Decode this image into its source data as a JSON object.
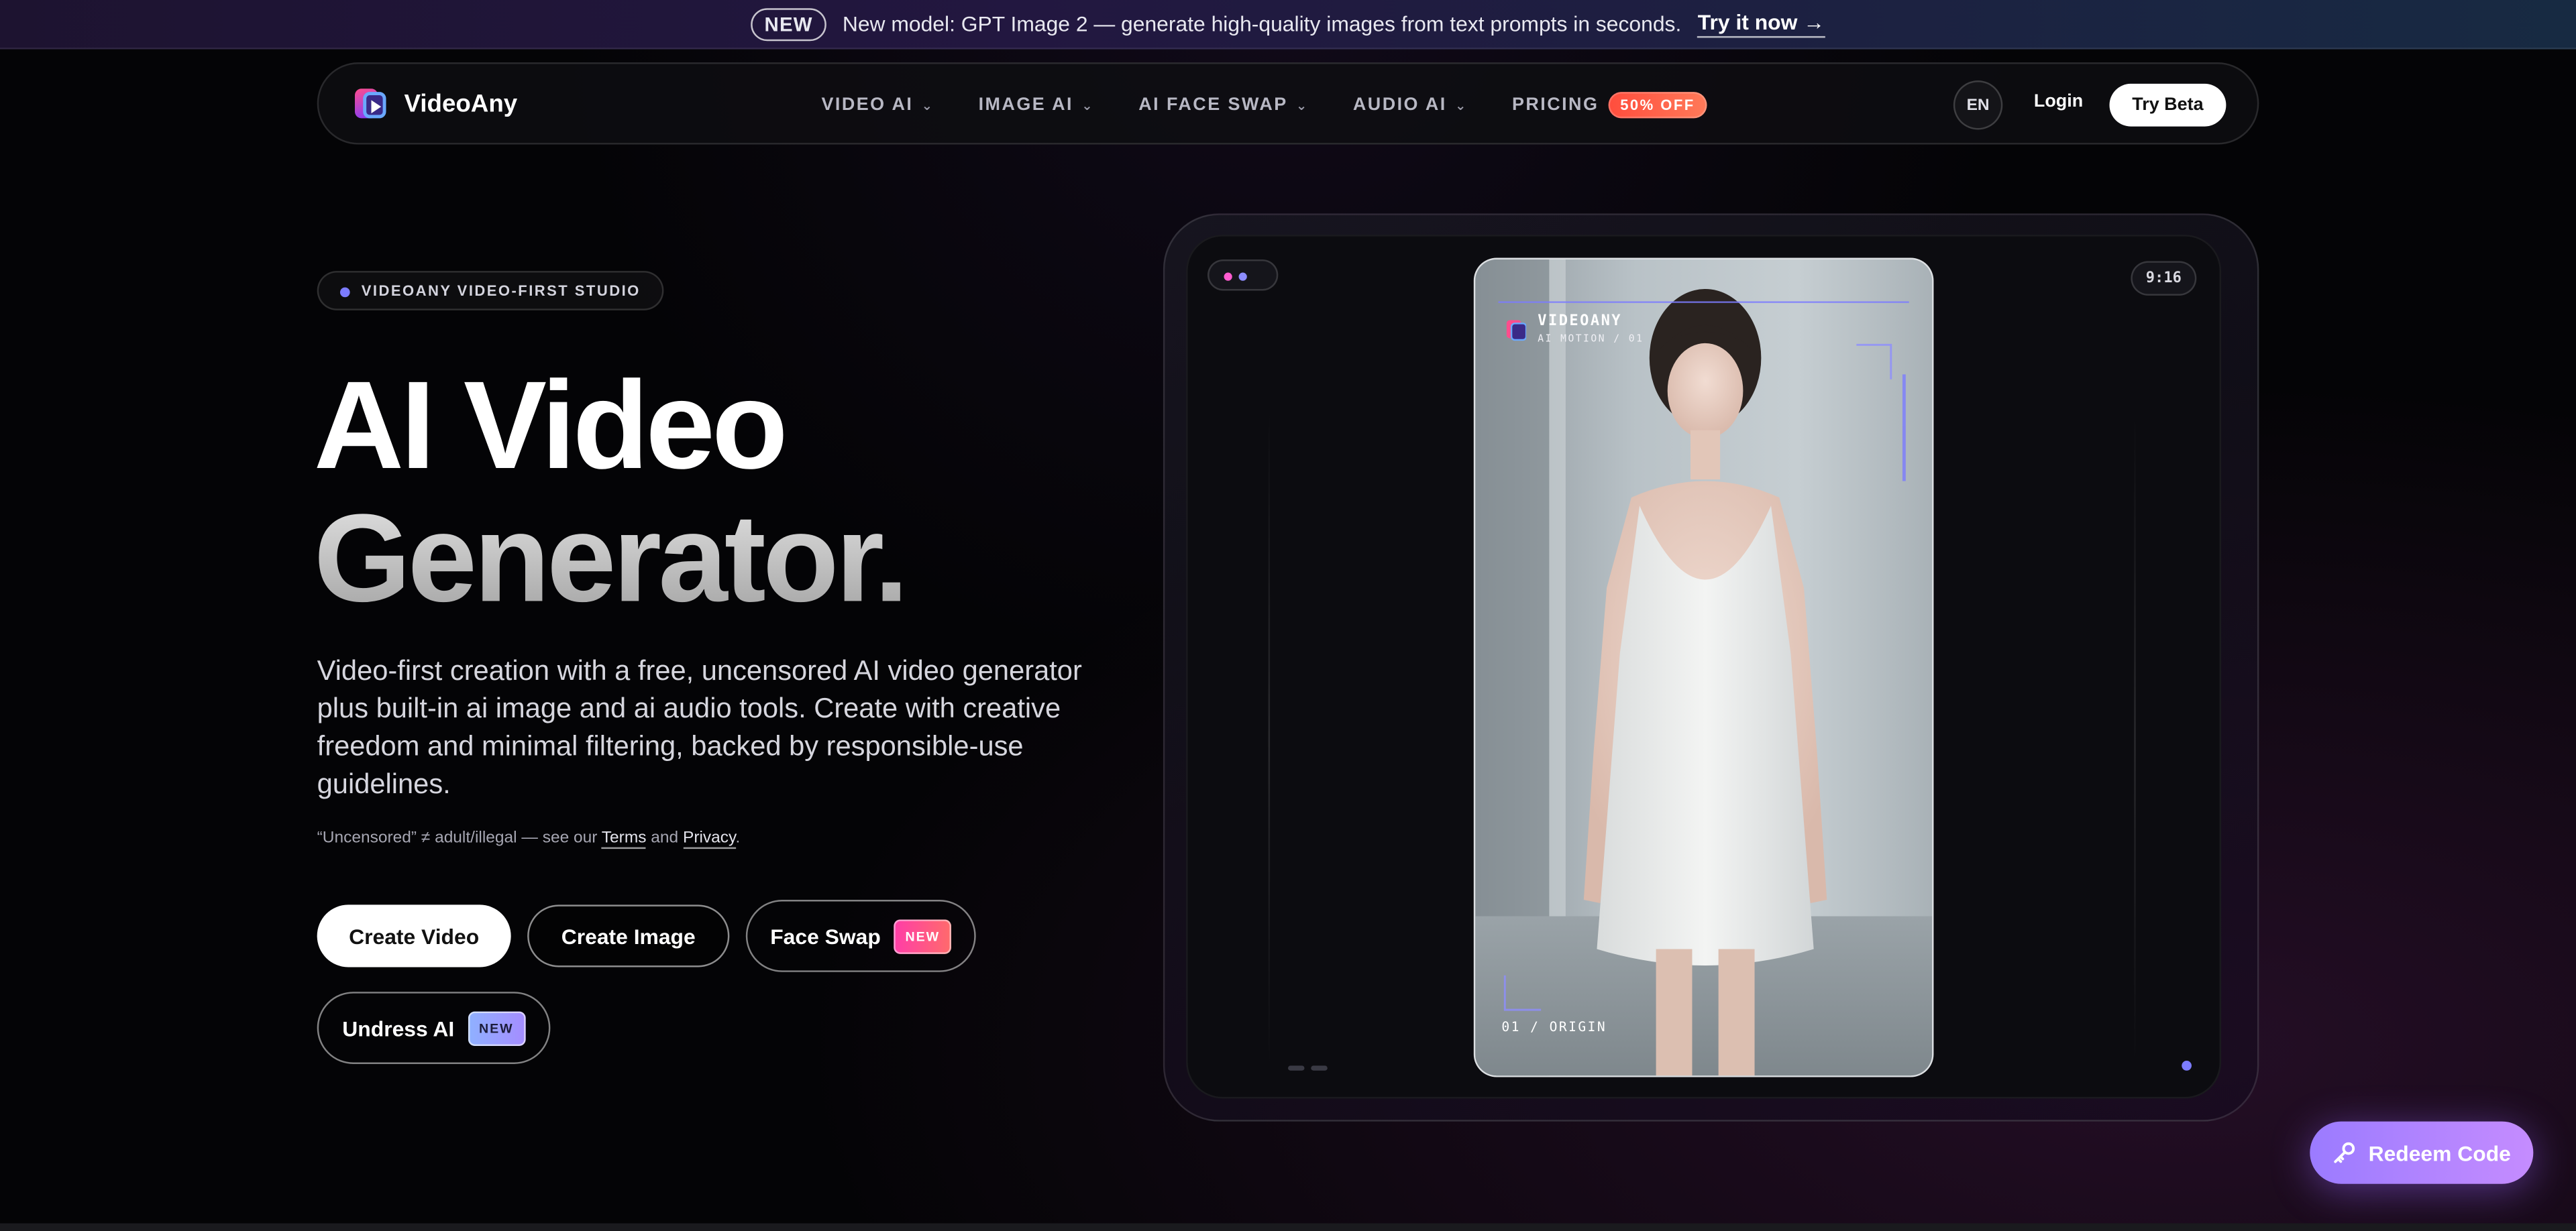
{
  "announcement": {
    "badge": "NEW",
    "text": "New model: GPT Image 2 — generate high-quality images from text prompts in seconds.",
    "cta": "Try it now →"
  },
  "nav": {
    "brand": "VideoAny",
    "items": [
      {
        "label": "VIDEO AI"
      },
      {
        "label": "IMAGE AI"
      },
      {
        "label": "AI FACE SWAP"
      },
      {
        "label": "AUDIO AI"
      }
    ],
    "pricing": "PRICING",
    "pricing_badge": "50% OFF",
    "lang": "EN",
    "login": "Login",
    "try_beta": "Try Beta"
  },
  "hero": {
    "eyebrow": "VIDEOANY VIDEO-FIRST STUDIO",
    "title_line1": "AI Video",
    "title_line2": "Generator.",
    "lead": "Video-first creation with a free, uncensored AI video generator plus built-in ai image and ai audio tools. Create with creative freedom and minimal filtering, backed by responsible-use guidelines.",
    "note_prefix": "“Uncensored” ≠ adult/illegal — see our",
    "note_terms": "Terms",
    "note_and": "and",
    "note_privacy": "Privacy",
    "note_suffix": ".",
    "buttons": {
      "create_video": "Create Video",
      "create_image": "Create Image",
      "face_swap": "Face Swap",
      "face_swap_tag": "NEW",
      "undress": "Undress AI",
      "undress_tag": "NEW"
    }
  },
  "preview": {
    "ratio": "9:16",
    "overlay_brand": "VIDEOANY",
    "overlay_sub": "AI MOTION / 01",
    "overlay_bottom": "01 / ORIGIN"
  },
  "redeem": {
    "label": "Redeem Code",
    "icon": "key-icon"
  },
  "colors": {
    "accent": "#7c7cff",
    "redeem_gradient_start": "#9b7bff",
    "redeem_gradient_end": "#c58cff",
    "badge_off": "#ff4d3d"
  }
}
